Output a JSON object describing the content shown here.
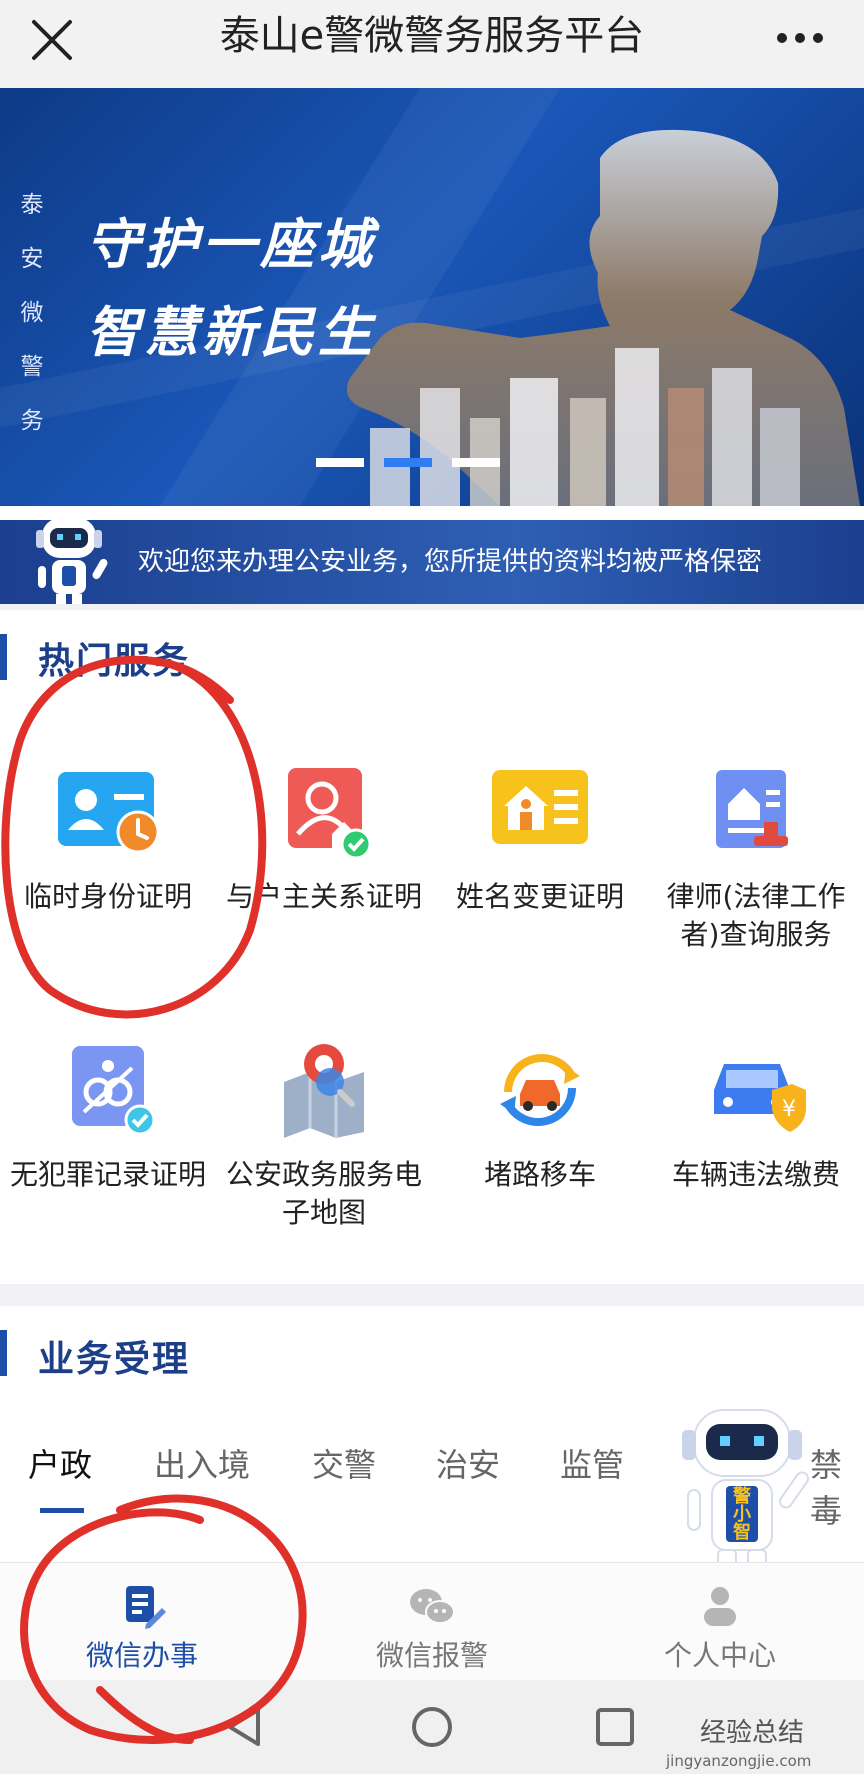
{
  "window": {
    "title": "泰山e警微警务服务平台",
    "close_icon": "close-icon",
    "more_icon": "more-dots-icon"
  },
  "banner": {
    "vertical_text": [
      "泰",
      "安",
      "微",
      "警",
      "务"
    ],
    "slogan_line1": "守护一座城",
    "slogan_line2": "智慧新民生",
    "carousel_active_index": 1,
    "carousel_count": 3
  },
  "welcome": {
    "text": "欢迎您来办理公安业务，您所提供的资料均被严格保密"
  },
  "hot_services": {
    "title": "热门服务",
    "items": [
      {
        "label": "临时身份证明",
        "icon": "id-card-clock-icon"
      },
      {
        "label": "与户主关系证明",
        "icon": "person-house-check-icon"
      },
      {
        "label": "姓名变更证明",
        "icon": "house-document-icon"
      },
      {
        "label": "律师(法律工作者)查询服务",
        "icon": "document-stamp-icon"
      },
      {
        "label": "无犯罪记录证明",
        "icon": "handcuffs-check-icon"
      },
      {
        "label": "公安政务服务电子地图",
        "icon": "map-pin-icon"
      },
      {
        "label": "堵路移车",
        "icon": "car-cycle-icon"
      },
      {
        "label": "车辆违法缴费",
        "icon": "car-yen-shield-icon"
      }
    ]
  },
  "business": {
    "title": "业务受理",
    "tabs": [
      "户政",
      "出入境",
      "交警",
      "治安",
      "监管",
      "禁毒"
    ],
    "active_tab": "户政"
  },
  "mascot": {
    "label": "警小智"
  },
  "bottom_nav": [
    {
      "label": "微信办事",
      "icon": "document-edit-icon",
      "active": true
    },
    {
      "label": "微信报警",
      "icon": "wechat-chat-icon",
      "active": false
    },
    {
      "label": "个人中心",
      "icon": "person-icon",
      "active": false
    }
  ],
  "colors": {
    "brand_blue": "#1d4ea8",
    "annotation_red": "#e0302a"
  },
  "watermark": {
    "text": "经验总结",
    "sub": "jingyanzongjie.com"
  }
}
